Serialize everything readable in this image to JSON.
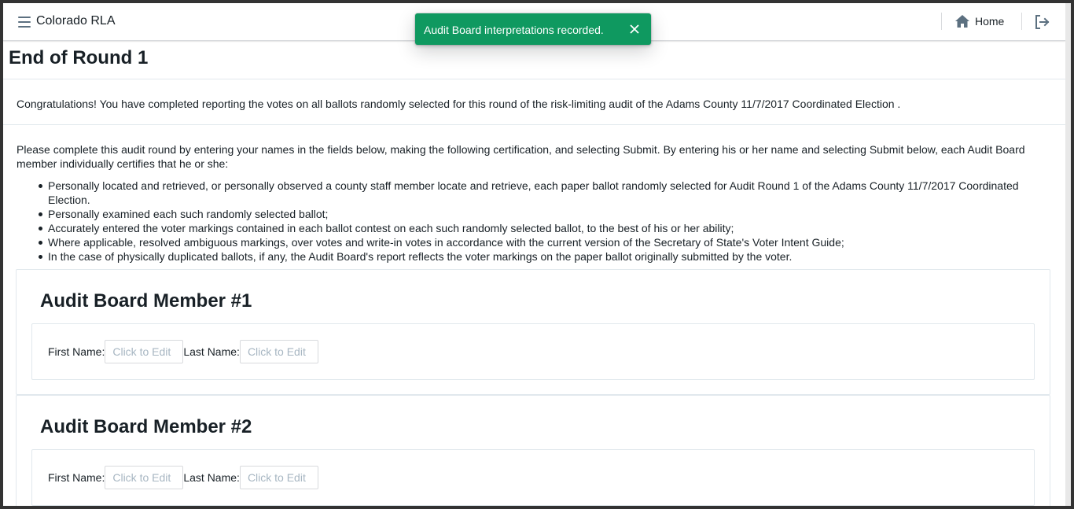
{
  "navbar": {
    "app_title": "Colorado RLA",
    "home_label": "Home",
    "menu_icon": "hamburger-menu-icon",
    "home_icon": "house-icon",
    "logout_icon": "log-out-icon"
  },
  "toast": {
    "message": "Audit Board interpretations recorded.",
    "color": "#0f9960",
    "close_icon": "close-icon"
  },
  "page": {
    "title": "End of Round 1",
    "congrats": "Congratulations! You have completed reporting the votes on all ballots randomly selected for this round of the risk-limiting audit of the Adams County 11/7/2017 Coordinated Election .",
    "instructions": "Please complete this audit round by entering your names in the fields below, making the following certification, and selecting Submit. By entering his or her name and selecting Submit below, each Audit Board member individually certifies that he or she:",
    "certifications": [
      "Personally located and retrieved, or personally observed a county staff member locate and retrieve, each paper ballot randomly selected for Audit Round 1 of the Adams County 11/7/2017 Coordinated Election.",
      "Personally examined each such randomly selected ballot;",
      "Accurately entered the voter markings contained in each ballot contest on each such randomly selected ballot, to the best of his or her ability;",
      "Where applicable, resolved ambiguous markings, over votes and write-in votes in accordance with the current version of the Secretary of State's Voter Intent Guide;",
      "In the case of physically duplicated ballots, if any, the Audit Board's report reflects the voter markings on the paper ballot originally submitted by the voter."
    ]
  },
  "members": [
    {
      "title": "Audit Board Member #1",
      "first_name_label": "First Name:",
      "first_name_placeholder": "Click to Edit",
      "last_name_label": "Last Name:",
      "last_name_placeholder": "Click to Edit"
    },
    {
      "title": "Audit Board Member #2",
      "first_name_label": "First Name:",
      "first_name_placeholder": "Click to Edit",
      "last_name_label": "Last Name:",
      "last_name_placeholder": "Click to Edit"
    }
  ]
}
